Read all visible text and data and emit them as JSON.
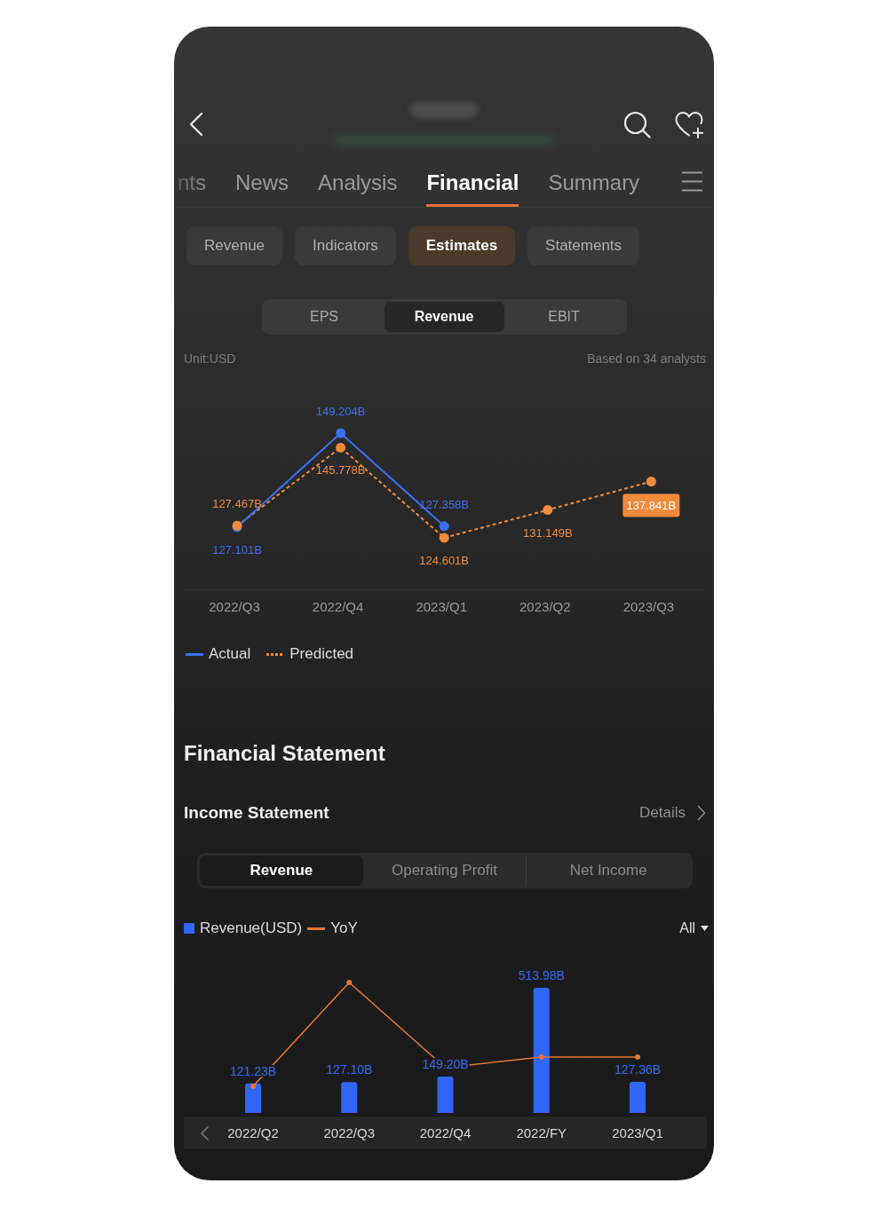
{
  "tabs": [
    {
      "label": "nts",
      "selected": false
    },
    {
      "label": "News",
      "selected": false
    },
    {
      "label": "Analysis",
      "selected": false
    },
    {
      "label": "Financial",
      "selected": true
    },
    {
      "label": "Summary",
      "selected": false
    }
  ],
  "chips": [
    {
      "label": "Revenue",
      "selected": false
    },
    {
      "label": "Indicators",
      "selected": false
    },
    {
      "label": "Estimates",
      "selected": true
    },
    {
      "label": "Statements",
      "selected": false
    }
  ],
  "estimates": {
    "segments": [
      {
        "label": "EPS",
        "selected": false
      },
      {
        "label": "Revenue",
        "selected": true
      },
      {
        "label": "EBIT",
        "selected": false
      }
    ],
    "unit": "Unit:USD",
    "analysts": "Based on 34 analysts",
    "chart_data": {
      "type": "line",
      "x": [
        "2022/Q3",
        "2022/Q4",
        "2023/Q1",
        "2023/Q2",
        "2023/Q3"
      ],
      "data_labels": true,
      "series": [
        {
          "name": "Actual",
          "color": "#3a70f5",
          "line_style": "solid",
          "marker": true,
          "values": [
            127.101,
            149.204,
            127.358,
            null,
            null
          ],
          "value_labels": [
            "127.101B",
            "149.204B",
            "127.358B",
            null,
            null
          ]
        },
        {
          "name": "Predicted",
          "color": "#f08a3c",
          "line_style": "dashed",
          "marker": true,
          "values": [
            127.467,
            145.778,
            124.601,
            131.149,
            137.841
          ],
          "value_labels": [
            "127.467B",
            "145.778B",
            "124.601B",
            "131.149B",
            "137.841B"
          ]
        }
      ]
    }
  },
  "financial_statement": {
    "title": "Financial Statement",
    "income_statement": {
      "title": "Income Statement",
      "details": "Details",
      "segments": [
        {
          "label": "Revenue",
          "selected": true
        },
        {
          "label": "Operating Profit",
          "selected": false
        },
        {
          "label": "Net Income",
          "selected": false
        }
      ],
      "yoy_line": {
        "name": "YoY",
        "color": "#e8742f"
      },
      "range": "All",
      "chart_data": {
        "type": "bar",
        "categories": [
          "2022/Q2",
          "2022/Q3",
          "2022/Q4",
          "2022/FY",
          "2023/Q1"
        ],
        "data_labels": true,
        "series": [
          {
            "name": "Revenue(USD)",
            "color": "#2f67f5",
            "values": [
              121.23,
              127.1,
              149.2,
              513.98,
              127.36
            ],
            "value_labels": [
              "121.23B",
              "127.10B",
              "149.20B",
              "513.98B",
              "127.36B"
            ]
          }
        ]
      }
    }
  }
}
